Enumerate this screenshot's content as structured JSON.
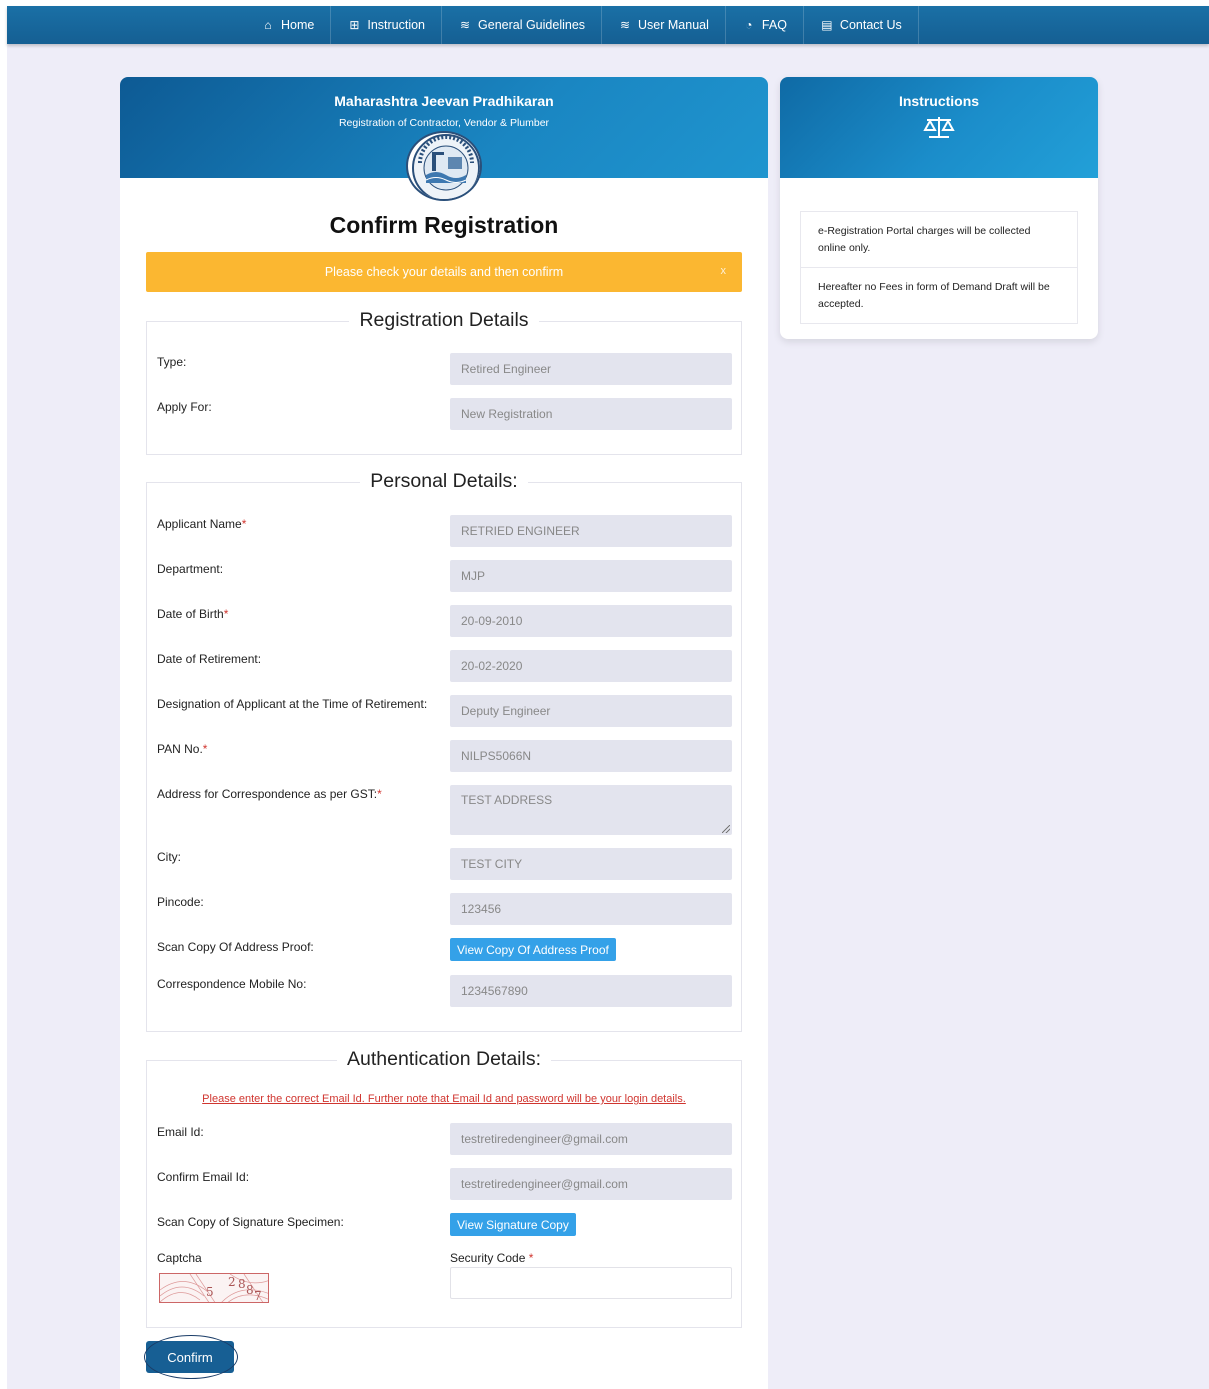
{
  "nav": {
    "items": [
      {
        "label": "Home",
        "icon": "home-icon",
        "glyph": "⌂"
      },
      {
        "label": "Instruction",
        "icon": "grid-icon",
        "glyph": "⊞"
      },
      {
        "label": "General Guidelines",
        "icon": "layers-icon",
        "glyph": "≋"
      },
      {
        "label": "User Manual",
        "icon": "layers-icon",
        "glyph": "≋"
      },
      {
        "label": "FAQ",
        "icon": "pie-icon",
        "glyph": "◔"
      },
      {
        "label": "Contact Us",
        "icon": "document-icon",
        "glyph": "▤"
      }
    ]
  },
  "header": {
    "org": "Maharashtra Jeevan Pradhikaran",
    "subtitle": "Registration of Contractor, Vendor & Plumber"
  },
  "page_title": "Confirm Registration",
  "alert": {
    "message": "Please check your details and then confirm",
    "close": "x"
  },
  "registration": {
    "title": "Registration Details",
    "type_label": "Type:",
    "type_value": "Retired Engineer",
    "apply_label": "Apply For:",
    "apply_value": "New Registration"
  },
  "personal": {
    "title": "Personal Details:",
    "name_label": "Applicant Name",
    "name_value": "RETRIED ENGINEER",
    "dept_label": "Department:",
    "dept_value": "MJP",
    "dob_label": "Date of Birth",
    "dob_value": "20-09-2010",
    "dor_label": "Date of Retirement:",
    "dor_value": "20-02-2020",
    "desig_label": "Designation of Applicant at the Time of Retirement:",
    "desig_value": "Deputy Engineer",
    "pan_label": "PAN No.",
    "pan_value": "NILPS5066N",
    "addr_label": "Address for Correspondence as per GST:",
    "addr_value": "TEST ADDRESS",
    "city_label": "City:",
    "city_value": "TEST CITY",
    "pin_label": "Pincode:",
    "pin_value": "123456",
    "proof_label": "Scan Copy Of Address Proof:",
    "proof_button": "View Copy Of Address Proof",
    "mobile_label": "Correspondence Mobile No:",
    "mobile_value": "1234567890"
  },
  "auth": {
    "title": "Authentication Details:",
    "warning": "Please enter the correct Email Id. Further note that Email Id and password will be your login details.",
    "email_label": "Email Id:",
    "email_value": "testretiredengineer@gmail.com",
    "confirm_email_label": "Confirm Email Id:",
    "confirm_email_value": "testretiredengineer@gmail.com",
    "sig_label": "Scan Copy of Signature Specimen:",
    "sig_button": "View Signature Copy",
    "captcha_label": "Captcha",
    "captcha_text": "52887",
    "security_label": "Security Code",
    "security_value": ""
  },
  "confirm_button": "Confirm",
  "required_mark": "*",
  "instructions": {
    "title": "Instructions",
    "icon": "scale-icon",
    "items": [
      "e-Registration Portal charges will be collected online only.",
      "Hereafter no Fees in form of Demand Draft will be accepted."
    ]
  }
}
